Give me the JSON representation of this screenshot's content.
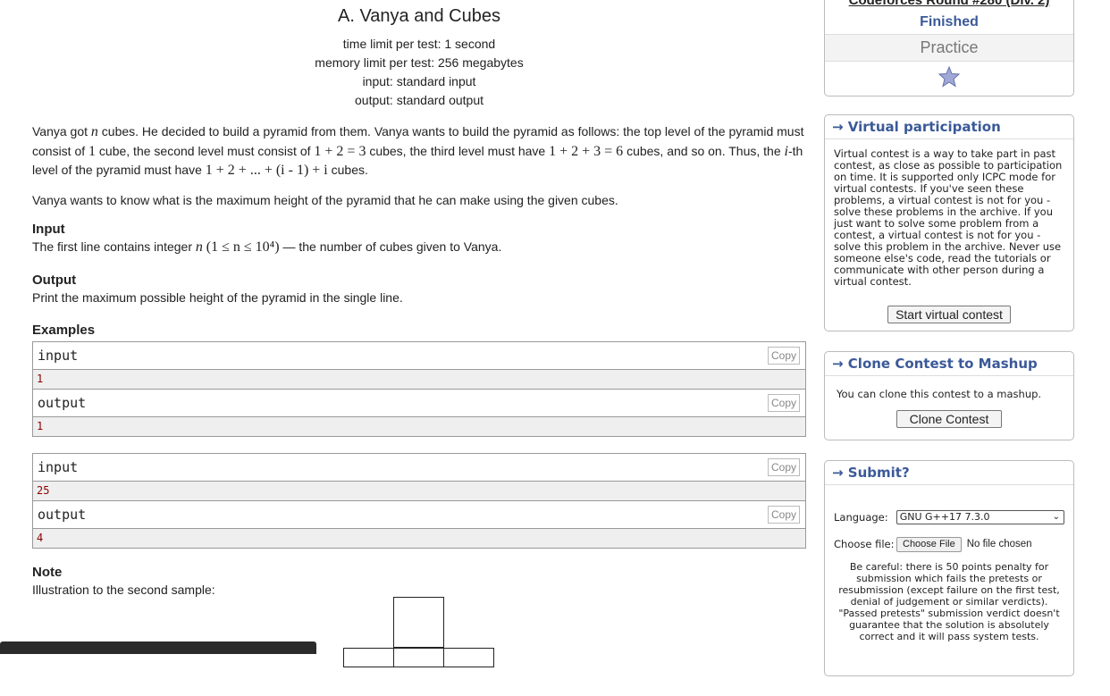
{
  "problem": {
    "title": "A. Vanya and Cubes",
    "time_limit": "time limit per test: 1 second",
    "memory_limit": "memory limit per test: 256 megabytes",
    "input": "input: standard input",
    "output": "output: standard output",
    "legend_1a": "Vanya got ",
    "legend_1b": " cubes. He decided to build a pyramid from them. Vanya wants to build the pyramid as follows: the top level of the pyramid must consist of ",
    "legend_1c": " cube, the second level must consist of ",
    "legend_1d": " cubes, the third level must have ",
    "legend_1e": " cubes, and so on. Thus, the ",
    "legend_1f": "-th level of the pyramid must have ",
    "legend_1g": " cubes.",
    "math_n": "n",
    "math_one": "1",
    "math_lvl2": "1 + 2 = 3",
    "math_lvl3": "1 + 2 + 3 = 6",
    "math_i": "i",
    "math_sum": "1 + 2 + ... + (i - 1) + i",
    "legend_2": "Vanya wants to know what is the maximum height of the pyramid that he can make using the given cubes.",
    "input_title": "Input",
    "input_text_a": "The first line contains integer ",
    "input_math": "(1 ≤ n ≤ 10⁴)",
    "input_text_b": " — the number of cubes given to Vanya.",
    "output_title": "Output",
    "output_text": "Print the maximum possible height of the pyramid in the single line.",
    "examples_title": "Examples",
    "samples": [
      {
        "input_label": "input",
        "input_value": "1",
        "output_label": "output",
        "output_value": "1"
      },
      {
        "input_label": "input",
        "input_value": "25",
        "output_label": "output",
        "output_value": "4"
      }
    ],
    "copy_label": "Copy",
    "note_title": "Note",
    "note_text": "Illustration to the second sample:"
  },
  "sidebar": {
    "contest_name": "Codeforces Round #280 (Div. 2)",
    "phase": "Finished",
    "practice": "Practice",
    "virtual": {
      "title": "→ Virtual participation",
      "text": "Virtual contest is a way to take part in past contest, as close as possible to participation on time. It is supported only ICPC mode for virtual contests. If you've seen these problems, a virtual contest is not for you - solve these problems in the archive. If you just want to solve some problem from a contest, a virtual contest is not for you - solve this problem in the archive. Never use someone else's code, read the tutorials or communicate with other person during a virtual contest.",
      "button": "Start virtual contest"
    },
    "clone": {
      "title": "→ Clone Contest to Mashup",
      "text": "You can clone this contest to a mashup.",
      "button": "Clone Contest"
    },
    "submit": {
      "title": "→ Submit?",
      "language_label": "Language:",
      "language_value": "GNU G++17 7.3.0",
      "file_label": "Choose file:",
      "file_button": "Choose File",
      "file_status": "No file chosen",
      "warning": "Be careful: there is 50 points penalty for submission which fails the pretests or resubmission (except failure on the first test, denial of judgement or similar verdicts). \"Passed pretests\" submission verdict doesn't guarantee that the solution is absolutely correct and it will pass system tests."
    }
  },
  "colors": {
    "accent": "#3b5998",
    "sample_bg": "#efefef",
    "star": "#a0a8d8"
  }
}
